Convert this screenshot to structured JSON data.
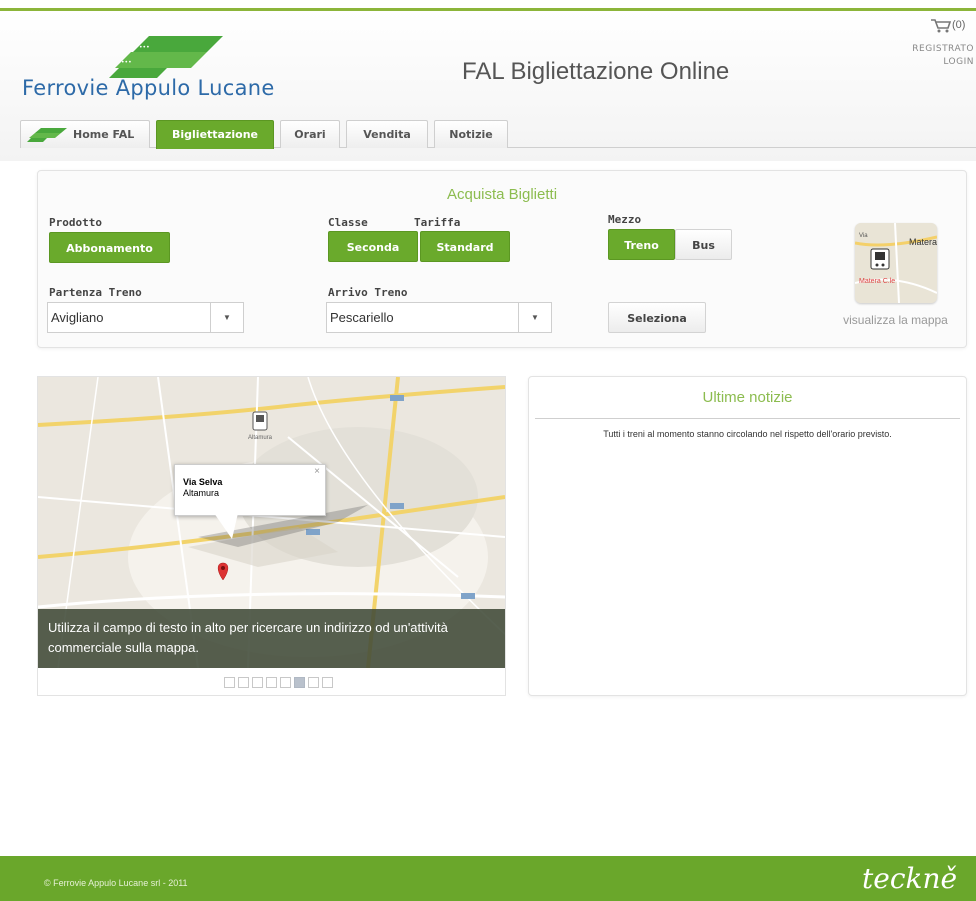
{
  "header": {
    "logo_text": "Ferrovie Appulo Lucane",
    "site_title": "FAL Bigliettazione Online",
    "cart_count": "(0)",
    "register_label": "REGISTRATO",
    "login_label": "LOGIN"
  },
  "tabs": [
    {
      "label": "Home FAL"
    },
    {
      "label": "Bigliettazione"
    },
    {
      "label": "Orari"
    },
    {
      "label": "Vendita"
    },
    {
      "label": "Notizie"
    }
  ],
  "purchase": {
    "title": "Acquista Biglietti",
    "product_label": "Prodotto",
    "product_value": "Abbonamento",
    "class_label": "Classe",
    "class_value": "Seconda",
    "tariff_label": "Tariffa",
    "tariff_value": "Standard",
    "transport_label": "Mezzo",
    "transport_train": "Treno",
    "transport_bus": "Bus",
    "departure_label": "Partenza Treno",
    "departure_value": "Avigliano",
    "arrival_label": "Arrivo Treno",
    "arrival_value": "Pescariello",
    "select_button": "Seleziona",
    "map_link": "visualizza la mappa",
    "thumb_labels": {
      "a": "Matera",
      "b": "Matera C.le",
      "c": "Via"
    }
  },
  "map": {
    "popup_title": "Via Selva",
    "popup_subtitle": "Altamura",
    "place_label": "Altamura",
    "caption": "Utilizza il campo di testo in alto per ricercare un indirizzo od un'attività commerciale sulla mappa.",
    "slides_total": 8,
    "slide_active": 6
  },
  "news": {
    "title": "Ultime notizie",
    "items": [
      "Tutti i treni al momento stanno circolando nel rispetto dell'orario previsto."
    ]
  },
  "footer": {
    "copyright": "© Ferrovie Appulo Lucane srl - 2011",
    "brand": "teckně"
  },
  "colors": {
    "accent": "#6aaa2c",
    "title_green": "#8cbc4f",
    "logo_blue": "#2d6aa8"
  }
}
